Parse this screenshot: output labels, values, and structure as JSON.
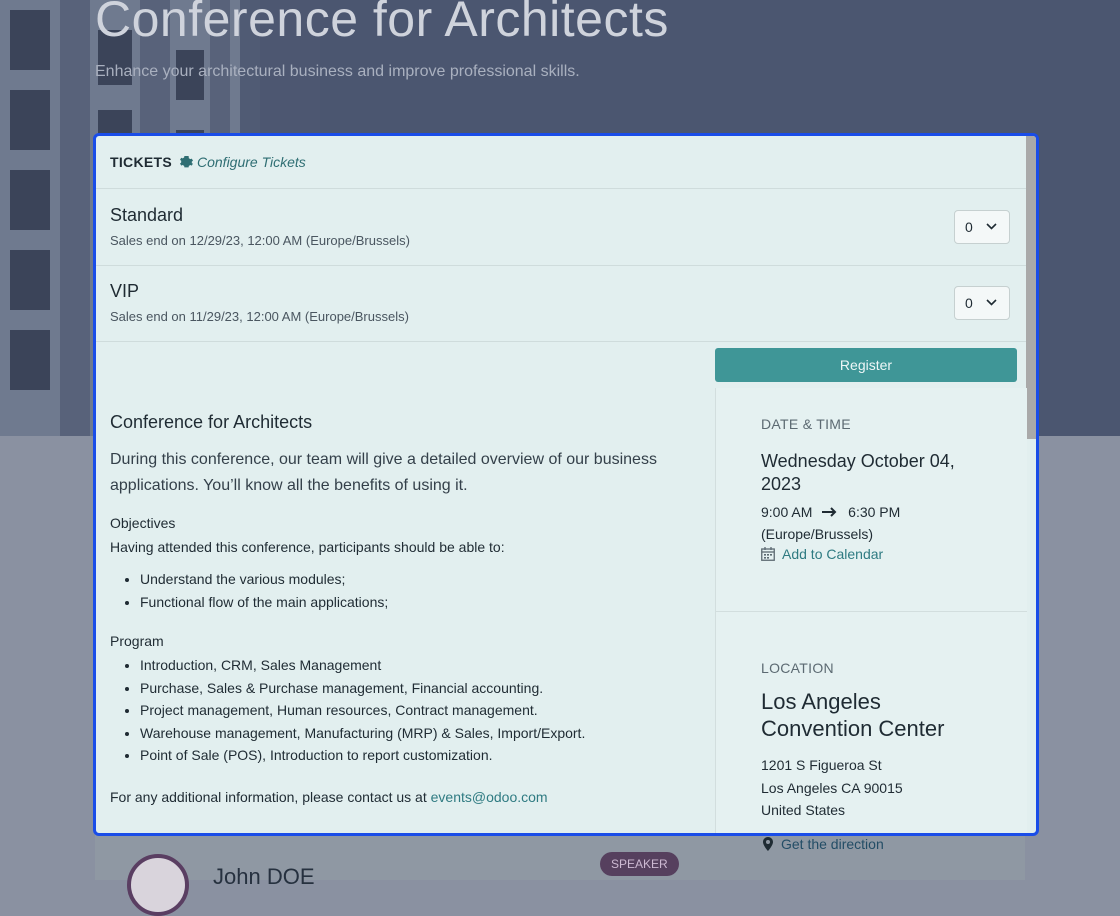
{
  "hero": {
    "title": "Conference for Architects",
    "subtitle": "Enhance your architectural business and improve professional skills."
  },
  "tickets": {
    "header": "TICKETS",
    "configure_label": "Configure Tickets",
    "items": [
      {
        "name": "Standard",
        "sales_end": "Sales end on 12/29/23, 12:00 AM (Europe/Brussels)",
        "quantity": "0"
      },
      {
        "name": "VIP",
        "sales_end": "Sales end on 11/29/23, 12:00 AM (Europe/Brussels)",
        "quantity": "0"
      }
    ],
    "register_label": "Register"
  },
  "description": {
    "title": "Conference for Architects",
    "lead": "During this conference, our team will give a detailed overview of our business applications. You’ll know all the benefits of using it.",
    "objectives_heading": "Objectives",
    "objectives_intro": "Having attended this conference, participants should be able to:",
    "objectives": [
      "Understand the various modules;",
      "Functional flow of the main applications;"
    ],
    "program_heading": "Program",
    "program": [
      "Introduction, CRM, Sales Management",
      "Purchase, Sales & Purchase management, Financial accounting.",
      "Project management, Human resources, Contract management.",
      "Warehouse management, Manufacturing (MRP) & Sales, Import/Export.",
      "Point of Sale (POS), Introduction to report customization."
    ],
    "contact_text": "For any additional information, please contact us at ",
    "contact_email": "events@odoo.com"
  },
  "sidebar": {
    "date_caption": "DATE & TIME",
    "date": "Wednesday October 04, 2023",
    "start_time": "9:00 AM",
    "end_time": "6:30 PM",
    "timezone": "(Europe/Brussels)",
    "add_to_calendar": "Add to Calendar",
    "location_caption": "LOCATION",
    "location_name": "Los Angeles Convention Center",
    "address_line1": "1201 S Figueroa St",
    "address_line2": "Los Angeles CA 90015",
    "address_line3": "United States",
    "get_direction": "Get the direction"
  },
  "speaker": {
    "name": "John DOE",
    "badge": "SPEAKER"
  },
  "colors": {
    "accent": "#3f9697",
    "focus_border": "#1a4de8",
    "link": "#2f7b82"
  }
}
